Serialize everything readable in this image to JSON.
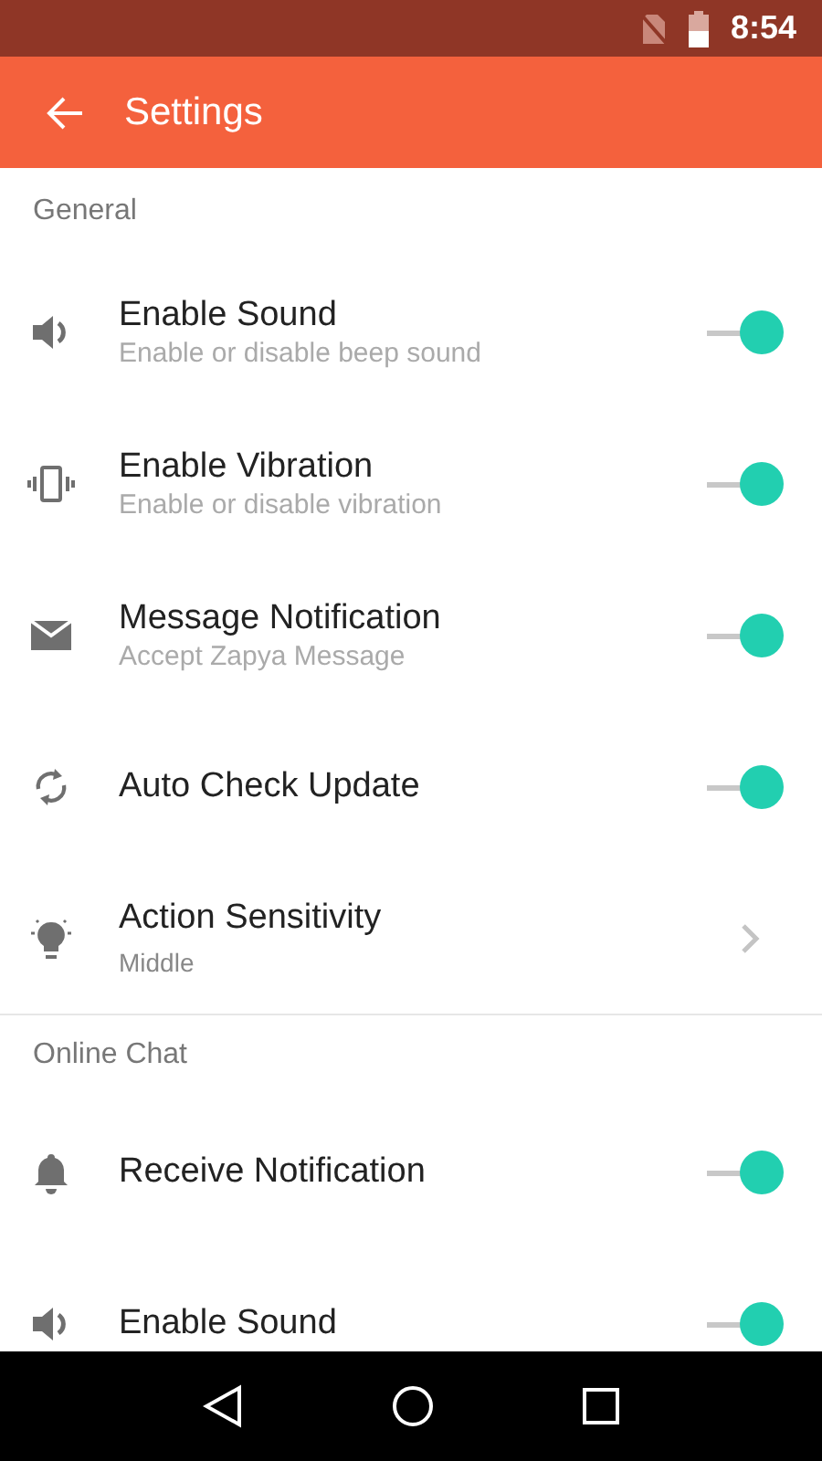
{
  "status_bar": {
    "time": "8:54"
  },
  "app_bar": {
    "title": "Settings"
  },
  "sections": [
    {
      "header": "General",
      "items": [
        {
          "kind": "toggle",
          "title": "Enable Sound",
          "subtitle": "Enable or disable beep sound",
          "on": true
        },
        {
          "kind": "toggle",
          "title": "Enable Vibration",
          "subtitle": "Enable or disable vibration",
          "on": true
        },
        {
          "kind": "toggle",
          "title": "Message Notification",
          "subtitle": "Accept Zapya Message",
          "on": true
        },
        {
          "kind": "toggle",
          "title": "Auto Check Update",
          "on": true
        },
        {
          "kind": "link",
          "title": "Action Sensitivity",
          "subtitle": "Middle"
        }
      ]
    },
    {
      "header": "Online Chat",
      "items": [
        {
          "kind": "toggle",
          "title": "Receive Notification",
          "on": true
        },
        {
          "kind": "toggle",
          "title": "Enable Sound",
          "on": true
        }
      ]
    }
  ]
}
